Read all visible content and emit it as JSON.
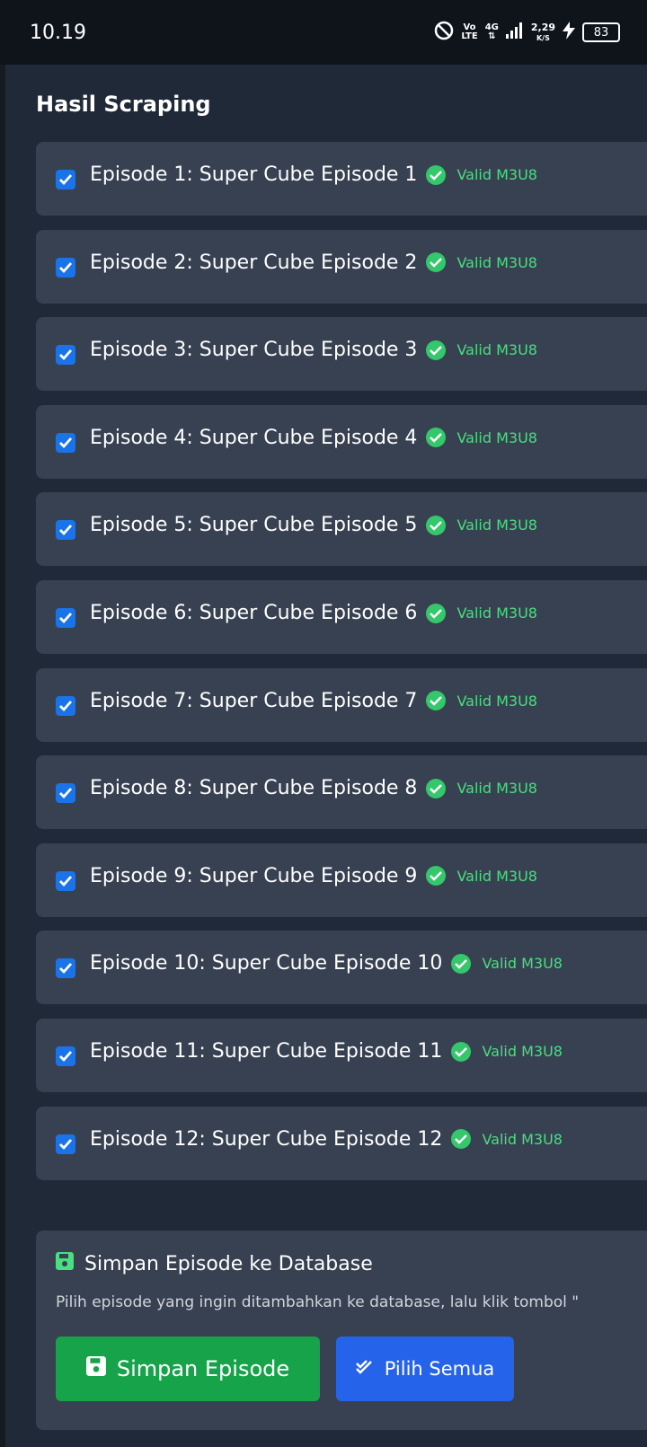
{
  "status_bar": {
    "time": "10.19",
    "volte_top": "Vo",
    "volte_bottom": "LTE",
    "network": "4G",
    "speed_value": "2,29",
    "speed_unit": "K/S",
    "battery": "83"
  },
  "panel": {
    "title": "Hasil Scraping",
    "episodes": [
      {
        "label": "Episode 1: Super Cube Episode 1",
        "status": "Valid M3U8"
      },
      {
        "label": "Episode 2: Super Cube Episode 2",
        "status": "Valid M3U8"
      },
      {
        "label": "Episode 3: Super Cube Episode 3",
        "status": "Valid M3U8"
      },
      {
        "label": "Episode 4: Super Cube Episode 4",
        "status": "Valid M3U8"
      },
      {
        "label": "Episode 5: Super Cube Episode 5",
        "status": "Valid M3U8"
      },
      {
        "label": "Episode 6: Super Cube Episode 6",
        "status": "Valid M3U8"
      },
      {
        "label": "Episode 7: Super Cube Episode 7",
        "status": "Valid M3U8"
      },
      {
        "label": "Episode 8: Super Cube Episode 8",
        "status": "Valid M3U8"
      },
      {
        "label": "Episode 9: Super Cube Episode 9",
        "status": "Valid M3U8"
      },
      {
        "label": "Episode 10: Super Cube Episode 10",
        "status": "Valid M3U8"
      },
      {
        "label": "Episode 11: Super Cube Episode 11",
        "status": "Valid M3U8"
      },
      {
        "label": "Episode 12: Super Cube Episode 12",
        "status": "Valid M3U8"
      }
    ],
    "save_section": {
      "heading": "Simpan Episode ke Database",
      "description": "Pilih episode yang ingin ditambahkan ke database, lalu klik tombol \"",
      "save_button": "Simpan Episode",
      "select_all_button": "Pilih Semua"
    }
  },
  "colors": {
    "panel_bg": "#1f2937",
    "card_bg": "#374151",
    "checkbox": "#1a73e8",
    "valid_green": "#4ade80",
    "save_button": "#16a34a",
    "select_all_button": "#2563eb"
  }
}
